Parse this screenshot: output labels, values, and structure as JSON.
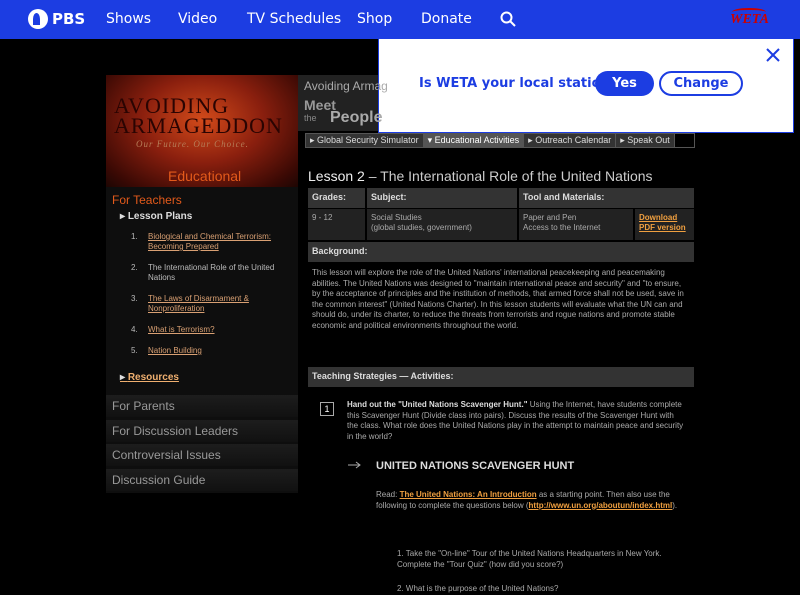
{
  "topnav": {
    "logo": "PBS",
    "items": [
      "Shows",
      "Video",
      "TV Schedules",
      "Shop",
      "Donate"
    ],
    "station_logo": "WETA"
  },
  "popup": {
    "question": "Is WETA your local station?",
    "yes": "Yes",
    "change": "Change"
  },
  "header": {
    "title_line1": "AVOIDING",
    "title_line2": "ARMAGEDDON",
    "tagline": "Our Future. Our Choice.",
    "section": "Educational Activities",
    "meet_top": "Avoiding Armag",
    "meet_a": "Meet",
    "meet_b": "the",
    "meet_c": "People"
  },
  "subnav": [
    "Global Security Simulator",
    "Educational Activities",
    "Outreach Calendar",
    "Speak Out"
  ],
  "sidebar": {
    "for_teachers": "For Teachers",
    "lesson_plans": "Lesson Plans",
    "lessons": [
      {
        "num": "1.",
        "text": "Biological and Chemical Terrorism: Becoming Prepared",
        "link": true
      },
      {
        "num": "2.",
        "text": "The International Role of the United Nations",
        "link": false
      },
      {
        "num": "3.",
        "text": "The Laws of Disarmament & Nonproliferation",
        "link": true
      },
      {
        "num": "4.",
        "text": "What is Terrorism?",
        "link": true
      },
      {
        "num": "5.",
        "text": "Nation Building",
        "link": true
      }
    ],
    "resources": "Resources",
    "bars": [
      "For Parents",
      "For Discussion Leaders",
      "Controversial Issues",
      "Discussion Guide"
    ]
  },
  "lesson": {
    "title_bold": "Lesson 2",
    "title_rest": " – The International Role of the United Nations",
    "grades_h": "Grades:",
    "subject_h": "Subject:",
    "tools_h": "Tool and Materials:",
    "grades": "9 - 12",
    "subject1": "Social Studies",
    "subject2": "(global studies, government)",
    "tools1": "Paper and Pen",
    "tools2": "Access to the Internet",
    "download1": "Download",
    "download2": "PDF version",
    "background_h": "Background:",
    "background": "This lesson will explore the role of the United Nations' international peacekeeping and peacemaking abilities. The United Nations was designed to \"maintain international peace and security\" and \"to ensure, by the acceptance of principles and the institution of methods, that armed force shall not be used, save in the common interest\" (United Nations Charter). In this lesson students will evaluate what the UN can and should do, under its charter, to reduce the threats from terrorists and rogue nations and promote stable economic and political environments throughout the world.",
    "strategies_h": "Teaching Strategies — Activities:",
    "step_num": "1",
    "step_bold": "Hand out the \"United Nations Scavenger Hunt.\"",
    "step_rest": " Using the Internet, have students complete this Scavenger Hunt (Divide class into pairs). Discuss the results of the Scavenger Hunt with the class. What role does the United Nations play in the attempt to maintain peace and security in the world?",
    "hunt_title": "UNITED NATIONS SCAVENGER HUNT",
    "read_pre": "Read: ",
    "read_link": "The United Nations: An Introduction",
    "read_post": " as a starting point. Then also use the following to complete the questions below (",
    "read_url": "http://www.un.org/aboutun/index.html",
    "read_end": ").",
    "q1": "1.  Take the \"On-line\" Tour of the United Nations Headquarters in New York. Complete the \"Tour Quiz\" (how did you score?)",
    "q2": "2.  What is the purpose of the United Nations?"
  }
}
